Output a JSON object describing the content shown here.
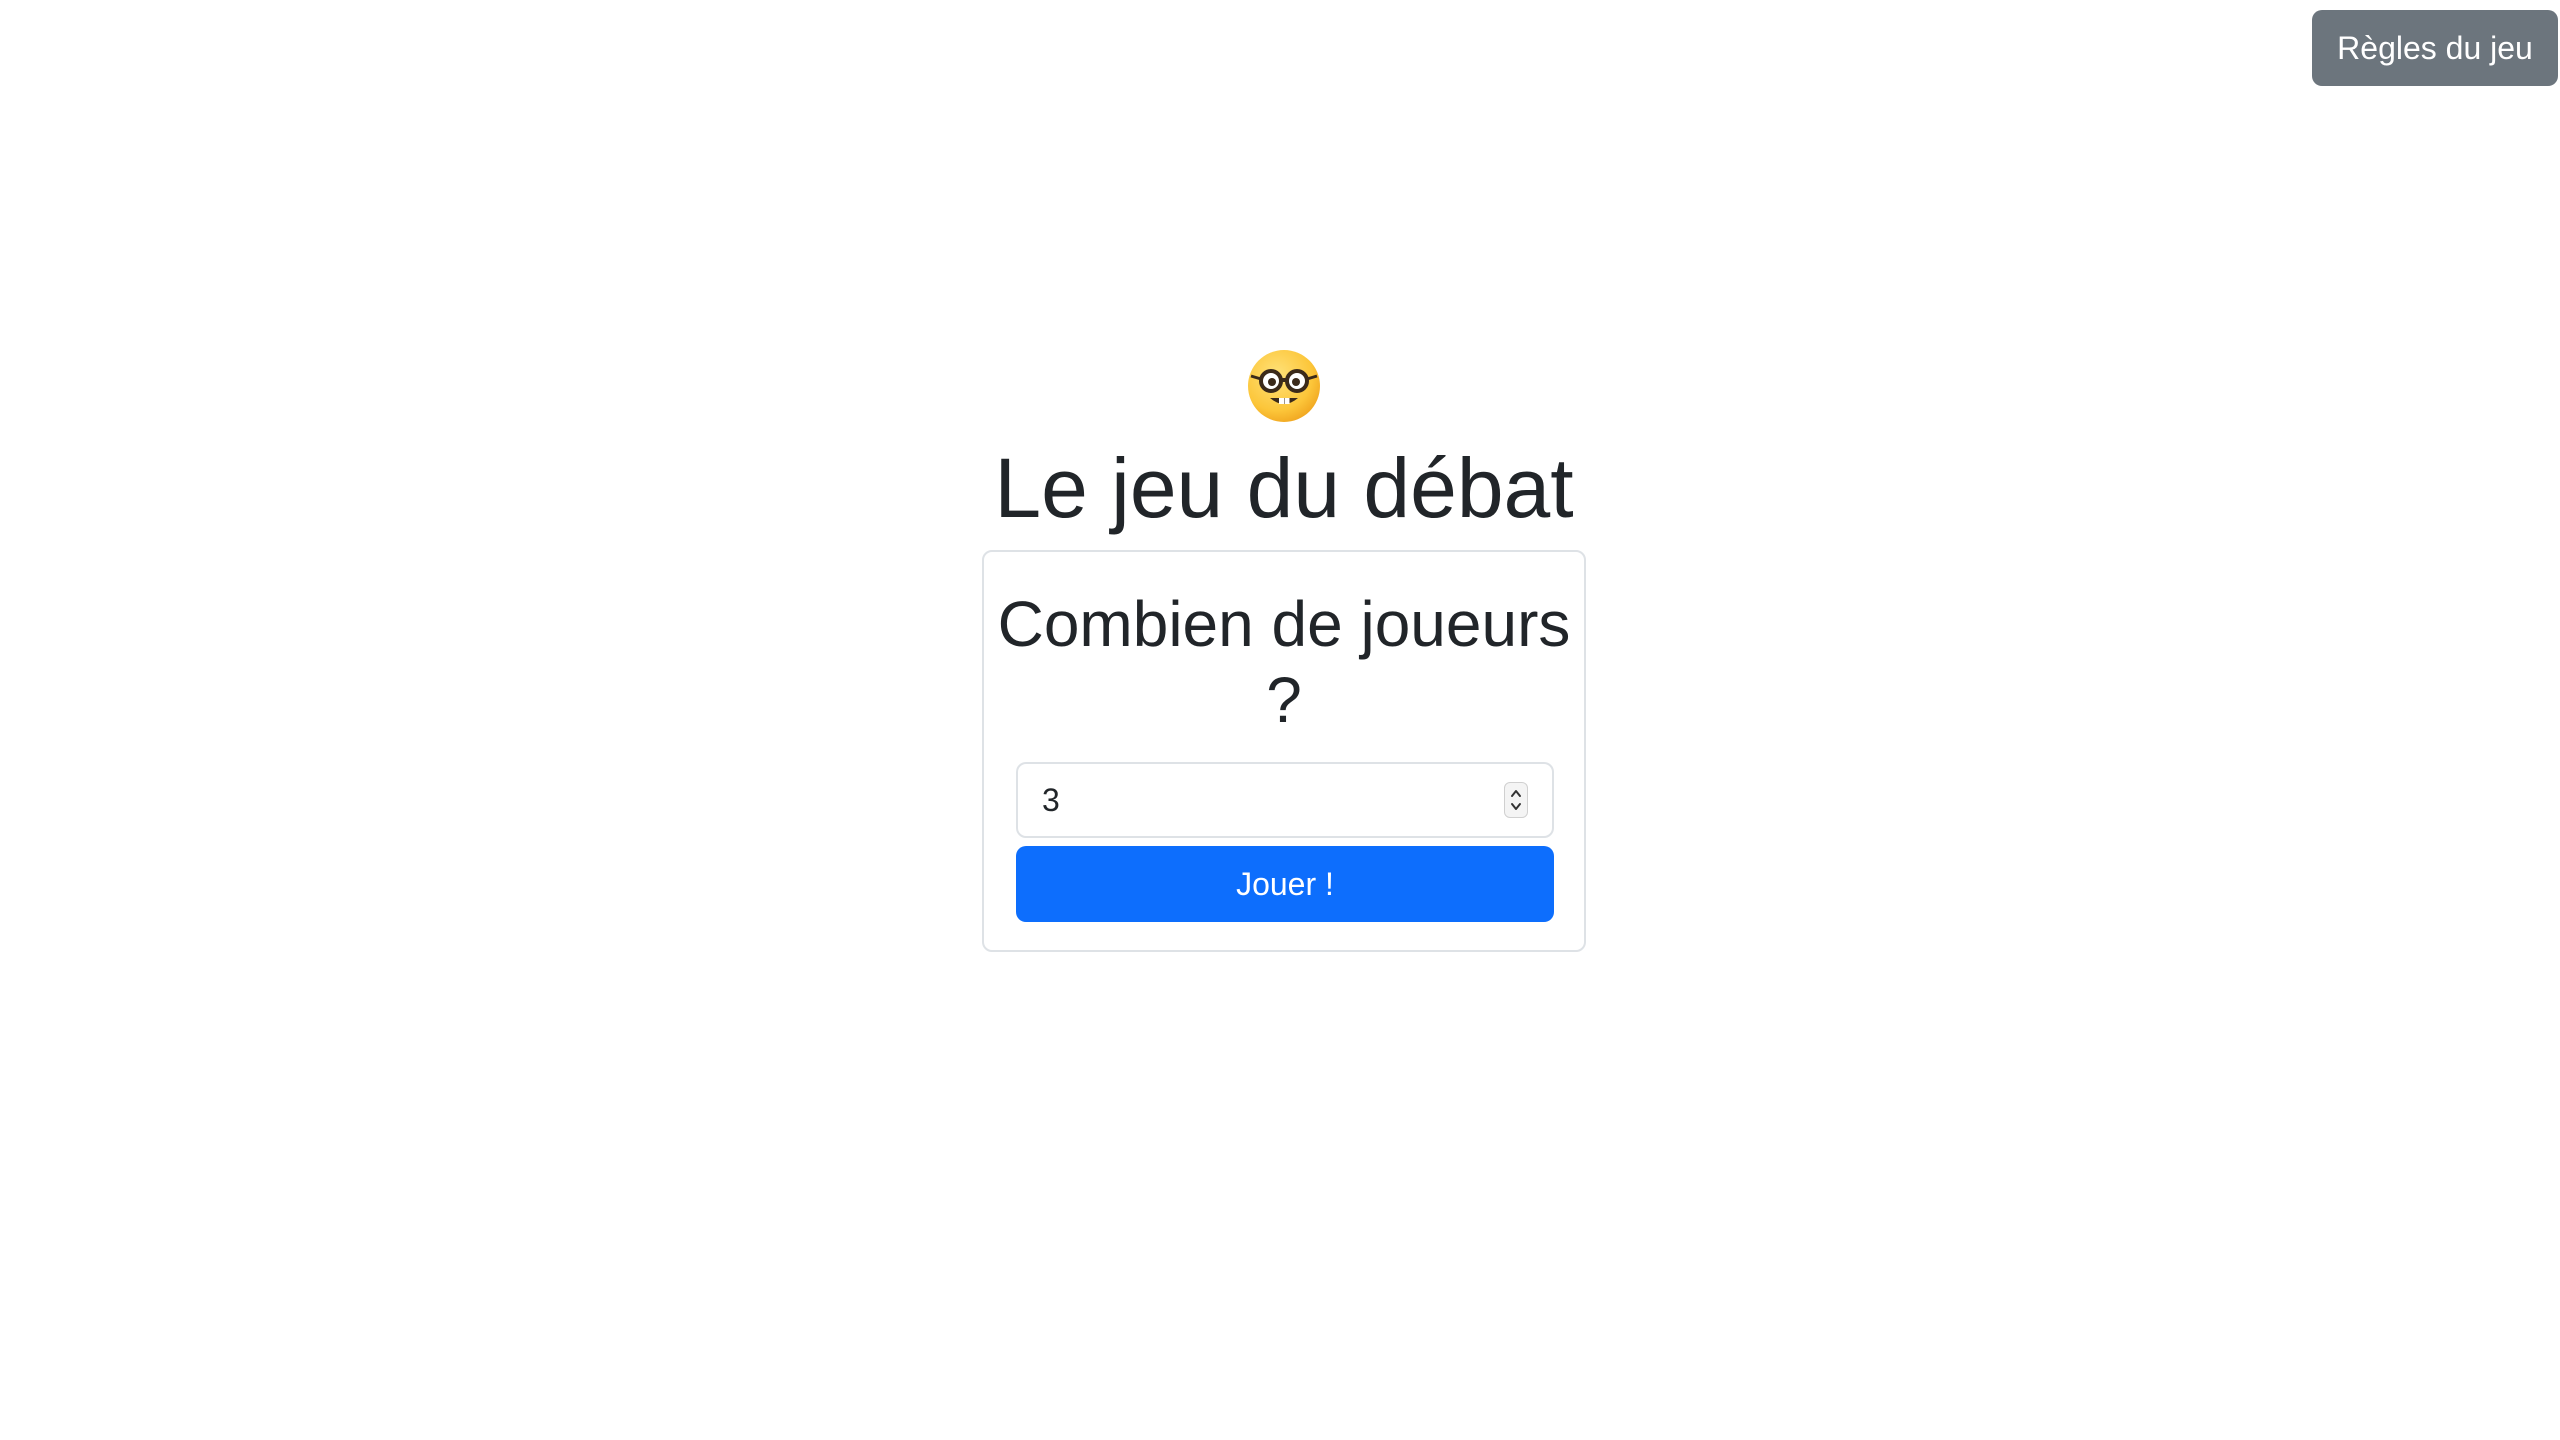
{
  "header": {
    "rules_button_label": "Règles du jeu"
  },
  "hero": {
    "emoji_icon": "nerd-face-icon",
    "title": "Le jeu du débat"
  },
  "setup_card": {
    "title": "Combien de joueurs ?",
    "player_count_value": "3",
    "play_button_label": "Jouer !"
  },
  "colors": {
    "secondary_button": "#6c757d",
    "primary_button": "#0d6efd",
    "text": "#212529",
    "border": "#dee2e6"
  }
}
